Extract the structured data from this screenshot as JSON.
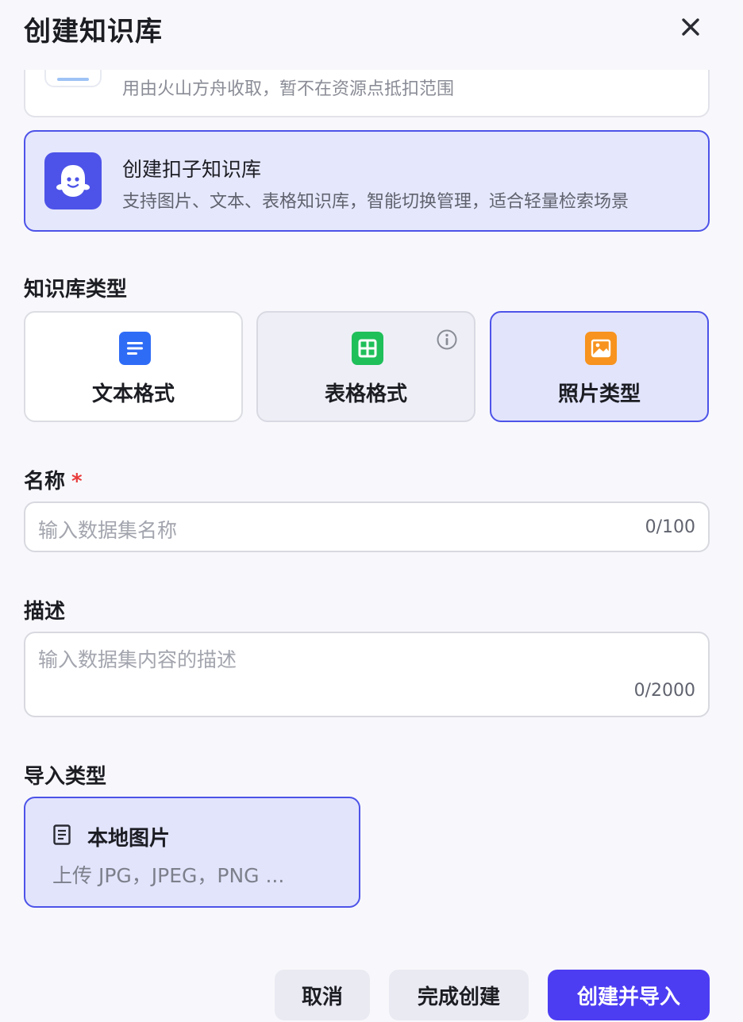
{
  "dialog": {
    "title": "创建知识库"
  },
  "options": [
    {
      "title": "",
      "desc": "用由火山方舟收取，暂不在资源点抵扣范围",
      "state": "partial"
    },
    {
      "title": "创建扣子知识库",
      "desc": "支持图片、文本、表格知识库，智能切换管理，适合轻量检索场景",
      "state": "selected"
    }
  ],
  "kb_type": {
    "label": "知识库类型",
    "items": [
      {
        "label": "文本格式",
        "icon": "text-doc-icon",
        "color": "#2f6cf6",
        "state": "default"
      },
      {
        "label": "表格格式",
        "icon": "table-icon",
        "color": "#1fbf5a",
        "state": "disabled"
      },
      {
        "label": "照片类型",
        "icon": "image-icon",
        "color": "#f7931e",
        "state": "selected"
      }
    ]
  },
  "name_field": {
    "label": "名称",
    "required_mark": "*",
    "placeholder": "输入数据集名称",
    "counter": "0/100"
  },
  "desc_field": {
    "label": "描述",
    "placeholder": "输入数据集内容的描述",
    "counter": "0/2000"
  },
  "import_type": {
    "label": "导入类型",
    "item": {
      "title": "本地图片",
      "desc": "上传 JPG，JPEG，PNG ..."
    }
  },
  "footer": {
    "cancel": "取消",
    "finish": "完成创建",
    "primary": "创建并导入"
  },
  "colors": {
    "accent": "#4d53e8",
    "primary_button": "#4d3df2",
    "required": "#e83b3b"
  }
}
